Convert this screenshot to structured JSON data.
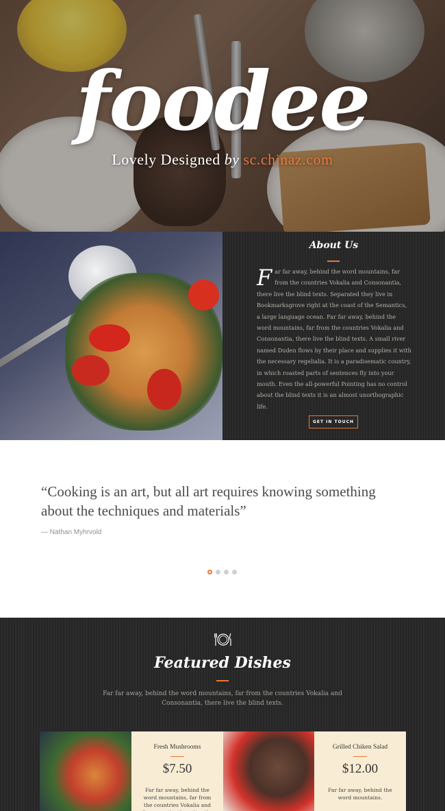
{
  "hero": {
    "title": "foodee",
    "subtitle_prefix": "Lovely Designed",
    "subtitle_by": "by",
    "subtitle_brand": "sc.chinaz.com"
  },
  "about": {
    "title": "About Us",
    "dropcap": "F",
    "text": "ar far away, behind the word mountains, far from the countries Vokalia and Consonantia, there live the blind texts. Separated they live in Bookmarksgrove right at the coast of the Semantics, a large language ocean. Far far away, behind the word mountains, far from the countries Vokalia and Consonantia, there live the blind texts. A small river named Duden flows by their place and supplies it with the necessary regelialia. It is a paradisematic country, in which roasted parts of sentences fly into your mouth. Even the all-powerful Pointing has no control about the blind texts it is an almost unorthographic life.",
    "button": "GET IN TOUCH"
  },
  "testimonial": {
    "quote": "“Cooking is an art, but all art requires knowing something about the techniques and materials”",
    "author": "— Nathan Myhrvold",
    "slides": 4,
    "active_slide": 1
  },
  "featured": {
    "title": "Featured Dishes",
    "description": "Far far away, behind the word mountains, far from the countries Vokalia and Consonantia, there live the blind texts.",
    "dishes": [
      {
        "name": "Fresh Mushrooms",
        "price": "$7.50",
        "description": "Far far away, behind the word mountains, far from the countries Vokalia and Consonantia, there live the blind"
      },
      {
        "name": "Grilled Chiken Salad",
        "price": "$12.00",
        "description": "Far far away, behind the word mountains."
      }
    ]
  },
  "colors": {
    "accent": "#e8783b",
    "dark_bg": "#292929",
    "card_bg": "#f8ecd4"
  }
}
